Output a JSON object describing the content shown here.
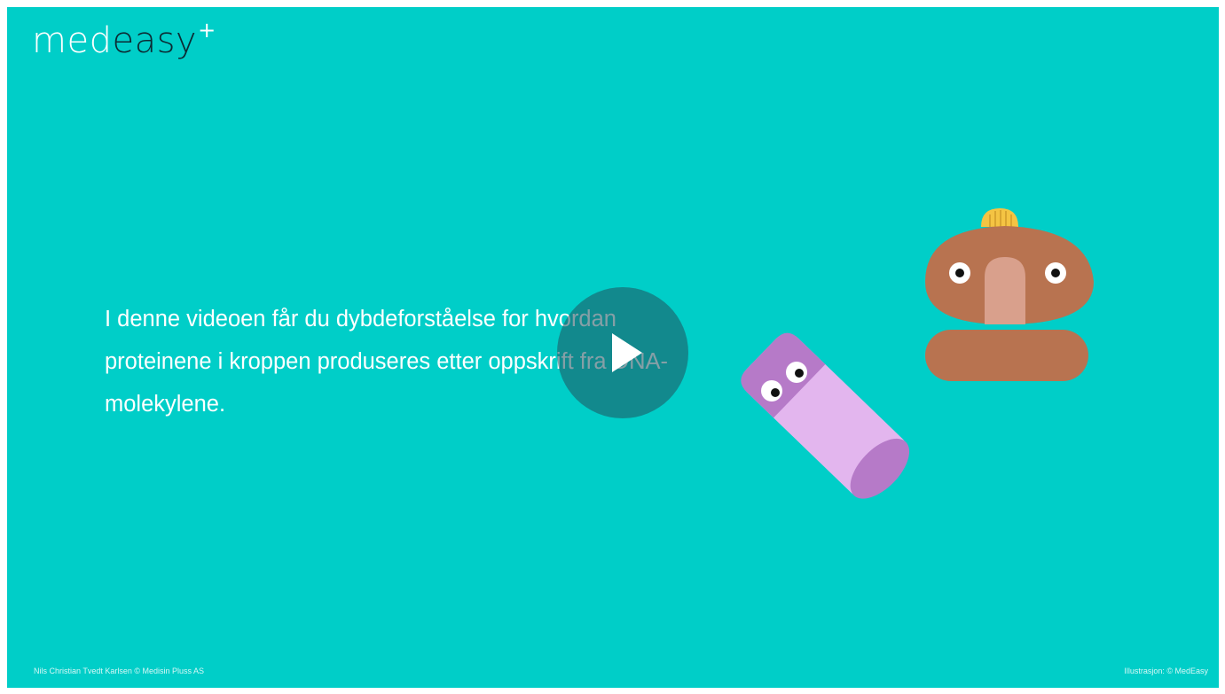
{
  "logo": {
    "part1": "med",
    "part2": "easy",
    "plus": "+"
  },
  "intro_text": "I denne videoen får du dybdeforståelse for hvordan proteinene i kroppen produseres etter oppskrift fra DNA-molekylene.",
  "play_button": {
    "icon": "play-icon"
  },
  "credits": {
    "author": "Nils Christian Tvedt Karlsen © Medisin Pluss AS",
    "illustration": "Illustrasjon: © MedEasy"
  },
  "colors": {
    "background": "#00cec8",
    "text": "#ffffff",
    "logo_accent": "#0c2a33",
    "ribosome": "#b87350",
    "ribosome_nose": "#d9a08c",
    "hat": "#f4c443",
    "pill_dark": "#b67ac8",
    "pill_light": "#e3b6ee"
  }
}
